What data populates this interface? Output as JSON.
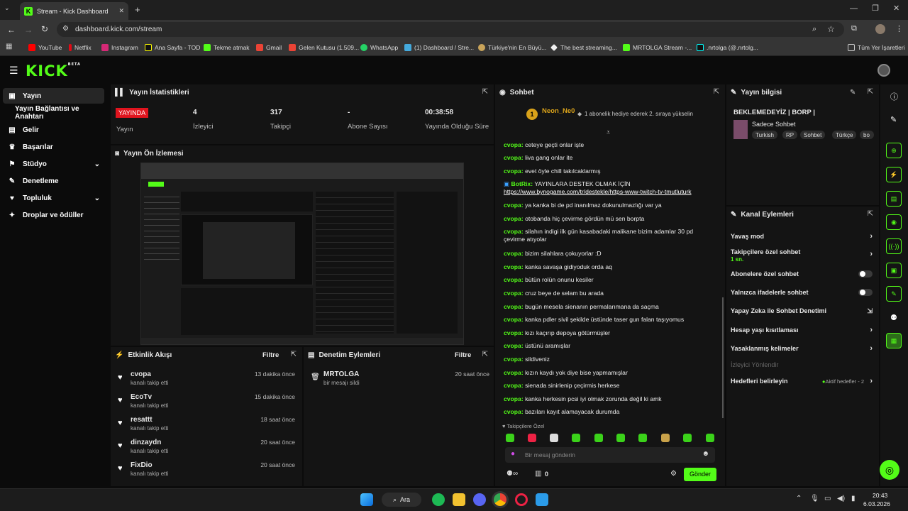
{
  "browser": {
    "tab_title": "Stream - Kick Dashboard",
    "url": "dashboard.kick.com/stream",
    "bookmarks": [
      "YouTube",
      "Netflix",
      "Instagram",
      "Ana Sayfa - TOD",
      "Tekme atmak",
      "Gmail",
      "Gelen Kutusu (1.509...",
      "WhatsApp",
      "(1) Dashboard / Stre...",
      "Türkiye'nin En Büyü...",
      "The best streaming...",
      "MRTOLGA Stream -...",
      ".nrtolga (@.nrtolg..."
    ],
    "all_bookmarks": "Tüm Yer İşaretleri"
  },
  "header": {
    "logo": "KICK",
    "beta": "BETA"
  },
  "sidebar": {
    "items": [
      {
        "label": "Yayın",
        "icon": "broadcast-icon"
      },
      {
        "label": "Yayın Bağlantısı ve Anahtarı",
        "icon": ""
      },
      {
        "label": "Gelir",
        "icon": "revenue-icon"
      },
      {
        "label": "Başarılar",
        "icon": "trophy-icon"
      },
      {
        "label": "Stüdyo",
        "icon": "studio-icon"
      },
      {
        "label": "Denetleme",
        "icon": "wrench-icon"
      },
      {
        "label": "Topluluk",
        "icon": "community-icon"
      },
      {
        "label": "Droplar ve ödüller",
        "icon": "drops-icon"
      }
    ]
  },
  "stats": {
    "title": "Yayın İstatistikleri",
    "live_badge": "YAYINDA",
    "live_label": "Yayın",
    "viewers_value": "4",
    "viewers_label": "İzleyici",
    "followers_value": "317",
    "followers_label": "Takipçi",
    "subs_value": "-",
    "subs_label": "Abone Sayısı",
    "duration_value": "00:38:58",
    "duration_label": "Yayında Olduğu Süre"
  },
  "preview": {
    "title": "Yayın Ön İzlemesi"
  },
  "activity": {
    "title": "Etkinlik Akışı",
    "filter": "Filtre",
    "items": [
      {
        "name": "cvopa",
        "action": "kanalı takip etti",
        "time": "13 dakika önce"
      },
      {
        "name": "EcoTv",
        "action": "kanalı takip etti",
        "time": "15 dakika önce"
      },
      {
        "name": "resattt",
        "action": "kanalı takip etti",
        "time": "18 saat önce"
      },
      {
        "name": "dinzaydn",
        "action": "kanalı takip etti",
        "time": "20 saat önce"
      },
      {
        "name": "FixDio",
        "action": "kanalı takip etti",
        "time": "20 saat önce"
      }
    ]
  },
  "moderation": {
    "title": "Denetim Eylemleri",
    "filter": "Filtre",
    "items": [
      {
        "name": "MRTOLGA",
        "action": "bir mesajı sildi",
        "time": "20 saat önce"
      }
    ]
  },
  "chat": {
    "title": "Sohbet",
    "pinned_user": "Neon_Ne0",
    "pinned_badge": "1",
    "pinned_text": "1 abonelik hediye ederek 2. sıraya yükselin",
    "messages": [
      {
        "user": "cvopa:",
        "text": "ceteye geçti onlar işte"
      },
      {
        "user": "cvopa:",
        "text": "liva gang onlar ite"
      },
      {
        "user": "cvopa:",
        "text": "evet öyle chill takılcaklarmış"
      },
      {
        "user": "BotRix:",
        "text": "YAYINLARA DESTEK OLMAK İÇİN"
      },
      {
        "user": "",
        "text": "https://www.bynogame.com/tr/destekle/https-www-twitch-tv-tmutluturk"
      },
      {
        "user": "cvopa:",
        "text": "ya kanka bi de pd inanılmaz dokunulmazlığı var ya"
      },
      {
        "user": "cvopa:",
        "text": "otobanda hiç çevirme gördün mü sen borpta"
      },
      {
        "user": "cvopa:",
        "text": "silahın indigi ilk gün kasabadaki malikane bizim adamlar 30 pd çevirme atıyolar"
      },
      {
        "user": "cvopa:",
        "text": "bizim silahlara çokuyorlar :D"
      },
      {
        "user": "cvopa:",
        "text": "kanka savaşa gidiyoduk orda aq"
      },
      {
        "user": "cvopa:",
        "text": "bütün rolün onunu kesiler"
      },
      {
        "user": "cvopa:",
        "text": "cruz beye de selam bu arada"
      },
      {
        "user": "cvopa:",
        "text": "bugün mesela sienanın permalarımana da saçma"
      },
      {
        "user": "cvopa:",
        "text": "kanka pdler sivil şekilde üstünde taser gun falan taşıyomus"
      },
      {
        "user": "cvopa:",
        "text": "kızı kaçırıp depoya götürmüşler"
      },
      {
        "user": "cvopa:",
        "text": "üstünü aramışlar"
      },
      {
        "user": "cvopa:",
        "text": "sildiveniz"
      },
      {
        "user": "cvopa:",
        "text": "kızın kaydı yok diye bise yapmamışlar"
      },
      {
        "user": "cvopa:",
        "text": "sienada sinirlenip çeçirmis herkese"
      },
      {
        "user": "cvopa:",
        "text": "kanka herkesin pcsi iyi olmak zorunda değil ki amk"
      },
      {
        "user": "cvopa:",
        "text": "bazıları kayıt alamayacak durumda"
      }
    ],
    "followers_only": "Takipçilere Özel",
    "input_placeholder": "Bir mesaj gönderin",
    "count": "0",
    "send": "Gönder"
  },
  "info": {
    "title": "Yayın bilgisi",
    "stream_title": "BEKLEMEDEYİZ | BORP |",
    "category": "Sadece Sohbet",
    "tags": [
      "Turkish",
      "RP",
      "Sohbet",
      "Türkçe",
      "bo"
    ]
  },
  "channel_actions": {
    "title": "Kanal Eylemleri",
    "slow_mode": "Yavaş mod",
    "followers_chat": "Takipçilere özel sohbet",
    "followers_chat_sub": "1 sn.",
    "subs_chat": "Abonelere özel sohbet",
    "emote_chat": "Yalnızca ifadelerle sohbet",
    "ai_moderation": "Yapay Zeka ile Sohbet Denetimi",
    "account_age": "Hesap yaşı kısıtlaması",
    "banned_words": "Yasaklanmış kelimeler",
    "viewer_redirect": "İzleyici Yönlendir",
    "set_goals": "Hedefleri belirleyin",
    "active_goals": "Aktif hedefler - 2"
  },
  "taskbar": {
    "search": "Ara",
    "time": "20:43",
    "date": "6.03.2026"
  },
  "colors": {
    "accent": "#53fc18",
    "live": "#e0141e",
    "panel": "#141414"
  }
}
